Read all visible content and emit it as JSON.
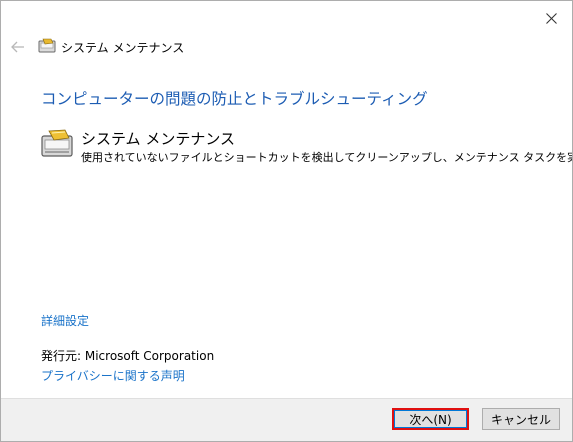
{
  "window": {
    "title": "システム メンテナンス",
    "heading": "コンピューターの問題の防止とトラブルシューティング"
  },
  "task": {
    "title": "システム メンテナンス",
    "description": "使用されていないファイルとショートカットを検出してクリーンアップし、メンテナンス タスクを実行します。"
  },
  "links": {
    "advanced": "詳細設定",
    "publisher": "発行元:  Microsoft Corporation",
    "privacy": "プライバシーに関する声明"
  },
  "buttons": {
    "next": "次へ(N)",
    "cancel": "キャンセル"
  },
  "colors": {
    "heading": "#1c5cb3",
    "link": "#1a73c9",
    "highlight": "#e01010"
  }
}
